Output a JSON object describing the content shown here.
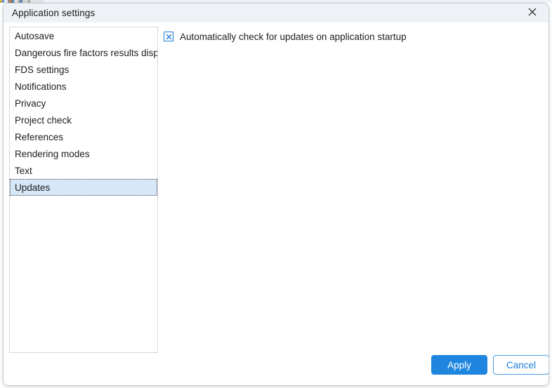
{
  "window": {
    "title": "Application settings",
    "close_icon": "close-icon"
  },
  "categories": {
    "items": [
      {
        "label": "Autosave",
        "selected": false
      },
      {
        "label": "Dangerous fire factors results display",
        "selected": false
      },
      {
        "label": "FDS settings",
        "selected": false
      },
      {
        "label": "Notifications",
        "selected": false
      },
      {
        "label": "Privacy",
        "selected": false
      },
      {
        "label": "Project check",
        "selected": false
      },
      {
        "label": "References",
        "selected": false
      },
      {
        "label": "Rendering modes",
        "selected": false
      },
      {
        "label": "Text",
        "selected": false
      },
      {
        "label": "Updates",
        "selected": true
      }
    ]
  },
  "settings_pane": {
    "options": [
      {
        "label": "Automatically check for updates on application startup",
        "checked": true
      }
    ]
  },
  "footer": {
    "apply_label": "Apply",
    "cancel_label": "Cancel"
  },
  "colors": {
    "titlebar_bg": "#eef2f6",
    "accent": "#1f86e0",
    "selection_bg": "#d6e7f8",
    "checkbox_border": "#1a7fd4",
    "cancel_border": "#4c9fe5",
    "text": "#1d1d1d"
  }
}
